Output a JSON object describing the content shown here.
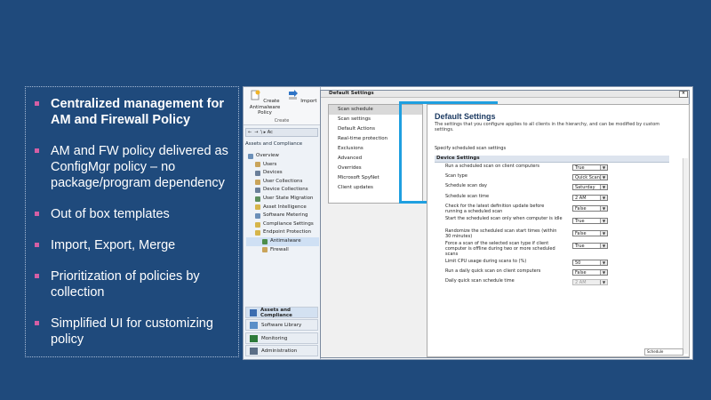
{
  "bullets": [
    {
      "text": "Centralized management for AM and Firewall Policy",
      "bold": true
    },
    {
      "text": "AM and FW policy delivered as ConfigMgr policy – no package/program dependency",
      "bold": false
    },
    {
      "text": "Out of box templates",
      "bold": false
    },
    {
      "text": "Import, Export, Merge",
      "bold": false
    },
    {
      "text": "Prioritization of policies by collection",
      "bold": false
    },
    {
      "text": "Simplified UI for customizing policy",
      "bold": false
    }
  ],
  "console": {
    "ribbon": {
      "create_label": "Create Antimalware Policy",
      "import_label": "Import",
      "group_label": "Create"
    },
    "nav_path": "\\ ▸ Ac",
    "tree_header": "Assets and Compliance",
    "tree": [
      {
        "label": "Overview",
        "icon_color": "#6b8fb8"
      },
      {
        "label": "Users",
        "icon_color": "#c9a45a"
      },
      {
        "label": "Devices",
        "icon_color": "#6a7f99"
      },
      {
        "label": "User Collections",
        "icon_color": "#c9a45a"
      },
      {
        "label": "Device Collections",
        "icon_color": "#6a7f99"
      },
      {
        "label": "User State Migration",
        "icon_color": "#5d8f5d"
      },
      {
        "label": "Asset Intelligence",
        "icon_color": "#d6b54a"
      },
      {
        "label": "Software Metering",
        "icon_color": "#6b8fb8"
      },
      {
        "label": "Compliance Settings",
        "icon_color": "#d6b54a"
      },
      {
        "label": "Endpoint Protection",
        "icon_color": "#d6b54a"
      },
      {
        "label": "Antimalware",
        "icon_color": "#4c8c4a"
      },
      {
        "label": "Firewall",
        "icon_color": "#c9a45a"
      }
    ],
    "workspaces": [
      {
        "label": "Assets and Compliance",
        "icon_color": "#3c6db0",
        "active": true
      },
      {
        "label": "Software Library",
        "icon_color": "#5a8fc8",
        "active": false
      },
      {
        "label": "Monitoring",
        "icon_color": "#2e7a3a",
        "active": false
      },
      {
        "label": "Administration",
        "icon_color": "#5b6e86",
        "active": false
      }
    ]
  },
  "dialog": {
    "title": "Default Settings",
    "close_label": "×",
    "sections": [
      "Scan schedule",
      "Scan settings",
      "Default Actions",
      "Real-time protection",
      "Exclusions",
      "Advanced",
      "Overrides",
      "Microsoft SpyNet",
      "Client updates"
    ],
    "selected_section": "Scan schedule",
    "heading": "Default Settings",
    "description": "The settings that you configure applies to all clients in the hierarchy, and can be modified by custom settings.",
    "specify_text": "Specify scheduled scan settings",
    "group_header": "Device Settings",
    "settings": [
      {
        "label": "Run a scheduled scan on client computers",
        "value": "True",
        "disabled": false
      },
      {
        "label": "Scan type",
        "value": "Quick Scan",
        "disabled": false
      },
      {
        "label": "Schedule scan day",
        "value": "Saturday",
        "disabled": false
      },
      {
        "label": "Schedule scan time",
        "value": "2 AM",
        "disabled": false
      },
      {
        "label": "Check for the latest definition update before running a scheduled scan",
        "value": "False",
        "disabled": false
      },
      {
        "label": "Start the scheduled scan only when computer is idle",
        "value": "True",
        "disabled": false
      },
      {
        "label": "Randomize the scheduled scan start times (within 30 minutes)",
        "value": "False",
        "disabled": false
      },
      {
        "label": "Force a scan of the selected scan type if client computer is offline during two or more scheduled scans",
        "value": "True",
        "disabled": false
      },
      {
        "label": "Limit CPU usage during scans to (%)",
        "value": "50",
        "disabled": false
      },
      {
        "label": "Run a daily quick scan on client computers",
        "value": "False",
        "disabled": false
      },
      {
        "label": "Daily quick scan schedule time",
        "value": "2 AM",
        "disabled": true
      }
    ],
    "footer_label": "Schedule"
  }
}
